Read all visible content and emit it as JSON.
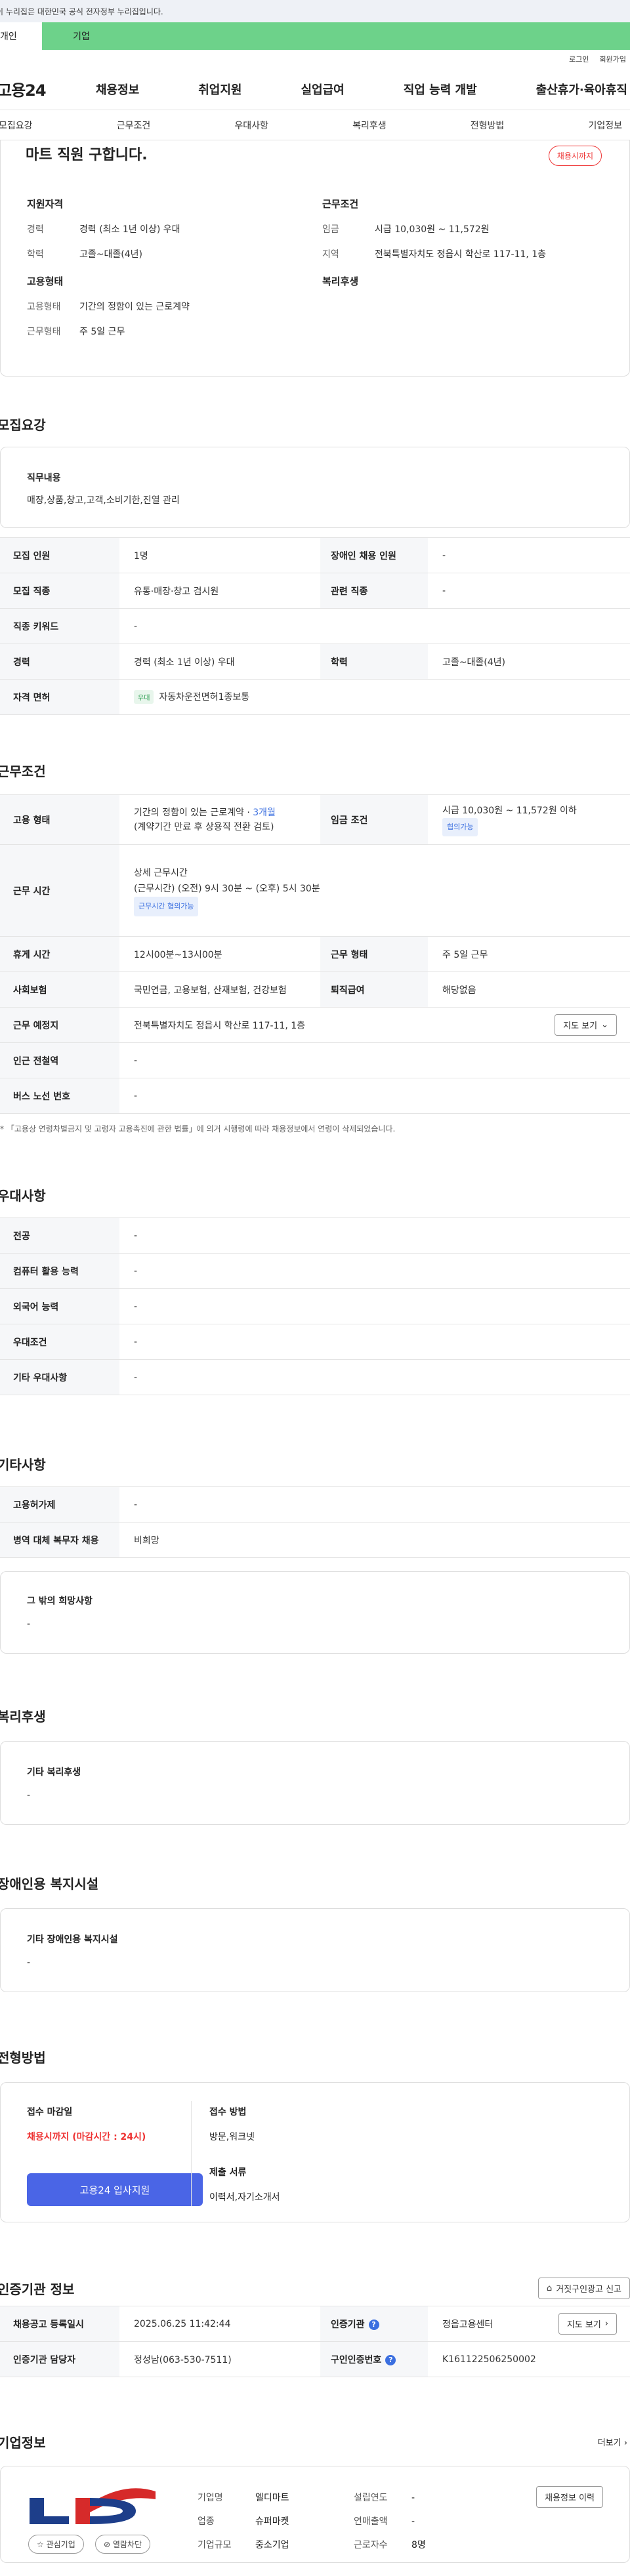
{
  "gov_banner": "이 누리집은 대한민국 공식 전자정부 누리집입니다.",
  "user_tabs": [
    "개인",
    "기업"
  ],
  "top_links": [
    "로그인",
    "회원가입"
  ],
  "logo": "고용24",
  "gnb": [
    "채용정보",
    "취업지원",
    "실업급여",
    "직업 능력 개발",
    "출산휴가·육아휴직"
  ],
  "subnav": [
    "모집요강",
    "근무조건",
    "우대사항",
    "복리후생",
    "전형방법",
    "기업정보"
  ],
  "summary": {
    "title": "마트 직원 구합니다.",
    "badge": "채용시까지",
    "qual_title": "지원자격",
    "qual": [
      {
        "k": "경력",
        "v": "경력 (최소 1년 이상) 우대"
      },
      {
        "k": "학력",
        "v": "고졸~대졸(4년)"
      }
    ],
    "cond_title": "근무조건",
    "cond": [
      {
        "k": "임금",
        "v": "시급 10,030원 ~ 11,572원"
      },
      {
        "k": "지역",
        "v": "전북특별자치도 정읍시 학산로 117-11, 1층"
      }
    ],
    "emp_title": "고용형태",
    "emp": [
      {
        "k": "고용형태",
        "v": "기간의 정함이 있는 근로계약"
      },
      {
        "k": "근무형태",
        "v": "주 5일 근무"
      }
    ],
    "welfare_title": "복리후생"
  },
  "recruit": {
    "title": "모집요강",
    "duty_label": "직무내용",
    "duty": "매장,상품,창고,고객,소비기한,진열 관리",
    "rows": [
      {
        "k1": "모집 인원",
        "v1": "1명",
        "k2": "장애인 채용 인원",
        "v2": "-"
      },
      {
        "k1": "모집 직종",
        "v1": "유통·매장·창고 검시원",
        "k2": "관련 직종",
        "v2": "-"
      },
      {
        "k1": "직종 키워드",
        "v1": "-"
      },
      {
        "k1": "경력",
        "v1": "경력 (최소 1년 이상) 우대",
        "k2": "학력",
        "v2": "고졸~대졸(4년)"
      }
    ],
    "license_label": "자격 면허",
    "license_tag": "우대",
    "license": "자동차운전면허1종보통"
  },
  "work": {
    "title": "근무조건",
    "emp_label": "고용 형태",
    "emp_v1": "기간의 정함이 있는 근로계약 · ",
    "emp_v1b": "3개월",
    "emp_v2": "(계약기간 만료 후 상용직 전환 검토)",
    "wage_label": "임금 조건",
    "wage": "시급 10,030원 ~ 11,572원 이하",
    "wage_tag": "협의가능",
    "time_label": "근무 시간",
    "time_h": "상세 근무시간",
    "time_v": "(근무시간) (오전) 9시 30분 ~ (오후) 5시 30분",
    "time_tag": "근무시간 협의가능",
    "rest_label": "휴게 시간",
    "rest": "12시00분~13시00분",
    "shift_label": "근무 형태",
    "shift": "주 5일 근무",
    "ins_label": "사회보험",
    "ins": "국민연금, 고용보험, 산재보험, 건강보험",
    "sev_label": "퇴직급여",
    "sev": "해당없음",
    "place_label": "근무 예정지",
    "place": "전북특별자치도 정읍시 학산로 117-11, 1층",
    "map_btn": "지도 보기",
    "subway_label": "인근 전철역",
    "subway": "-",
    "bus_label": "버스 노선 번호",
    "bus": "-",
    "note": "* 「고용상 연령차별금지 및 고령자 고용촉진에 관한 법률」에 의거 시행령에 따라 채용정보에서 연령이 삭제되었습니다."
  },
  "pref": {
    "title": "우대사항",
    "rows": [
      {
        "k": "전공",
        "v": "-"
      },
      {
        "k": "컴퓨터 활용 능력",
        "v": "-"
      },
      {
        "k": "외국어 능력",
        "v": "-"
      },
      {
        "k": "우대조건",
        "v": "-"
      },
      {
        "k": "기타 우대사항",
        "v": "-"
      }
    ]
  },
  "etc": {
    "title": "기타사항",
    "rows": [
      {
        "k": "고용허가제",
        "v": "-"
      },
      {
        "k": "병역 대체 복무자 채용",
        "v": "비희망"
      }
    ],
    "hope_label": "그 밖의 희망사항",
    "hope": "-"
  },
  "welfare": {
    "title": "복리후생",
    "label": "기타 복리후생",
    "v": "-"
  },
  "disabled": {
    "title": "장애인용 복지시설",
    "label": "기타 장애인용 복지시설",
    "v": "-"
  },
  "process": {
    "title": "전형방법",
    "deadline_label": "접수 마감일",
    "deadline": "채용시까지 (마감시간 : 24시)",
    "apply_btn": "고용24 입사지원",
    "method_label": "접수 방법",
    "method": "방문,워크넷",
    "docs_label": "제출 서류",
    "docs": "이력서,자기소개서"
  },
  "cert": {
    "title": "인증기관 정보",
    "report_btn": "거짓구인광고 신고",
    "r1k1": "채용공고 등록일시",
    "r1v1": "2025.06.25 11:42:44",
    "r1k2": "인증기관",
    "r1v2": "정읍고용센터",
    "map_btn": "지도 보기",
    "r2k1": "인증기관 담당자",
    "r2v1": "정성남(063-530-7511)",
    "r2k2": "구인인증번호",
    "r2v2": "K161122506250002"
  },
  "company": {
    "title": "기업정보",
    "more": "더보기",
    "rows": [
      {
        "k1": "기업명",
        "v1": "엘디마트",
        "k2": "설립연도",
        "v2": "-"
      },
      {
        "k1": "업종",
        "v1": "슈퍼마켓",
        "k2": "연매출액",
        "v2": "-"
      },
      {
        "k1": "기업규모",
        "v1": "중소기업",
        "k2": "근로자수",
        "v2": "8명"
      }
    ],
    "history_btn": "채용정보 이력",
    "fav_btn": "관심기업",
    "block_btn": "열람차단"
  },
  "colors": {
    "green": "#6dd28a",
    "accent_red": "#e33333",
    "accent_blue": "#4a65e6"
  }
}
